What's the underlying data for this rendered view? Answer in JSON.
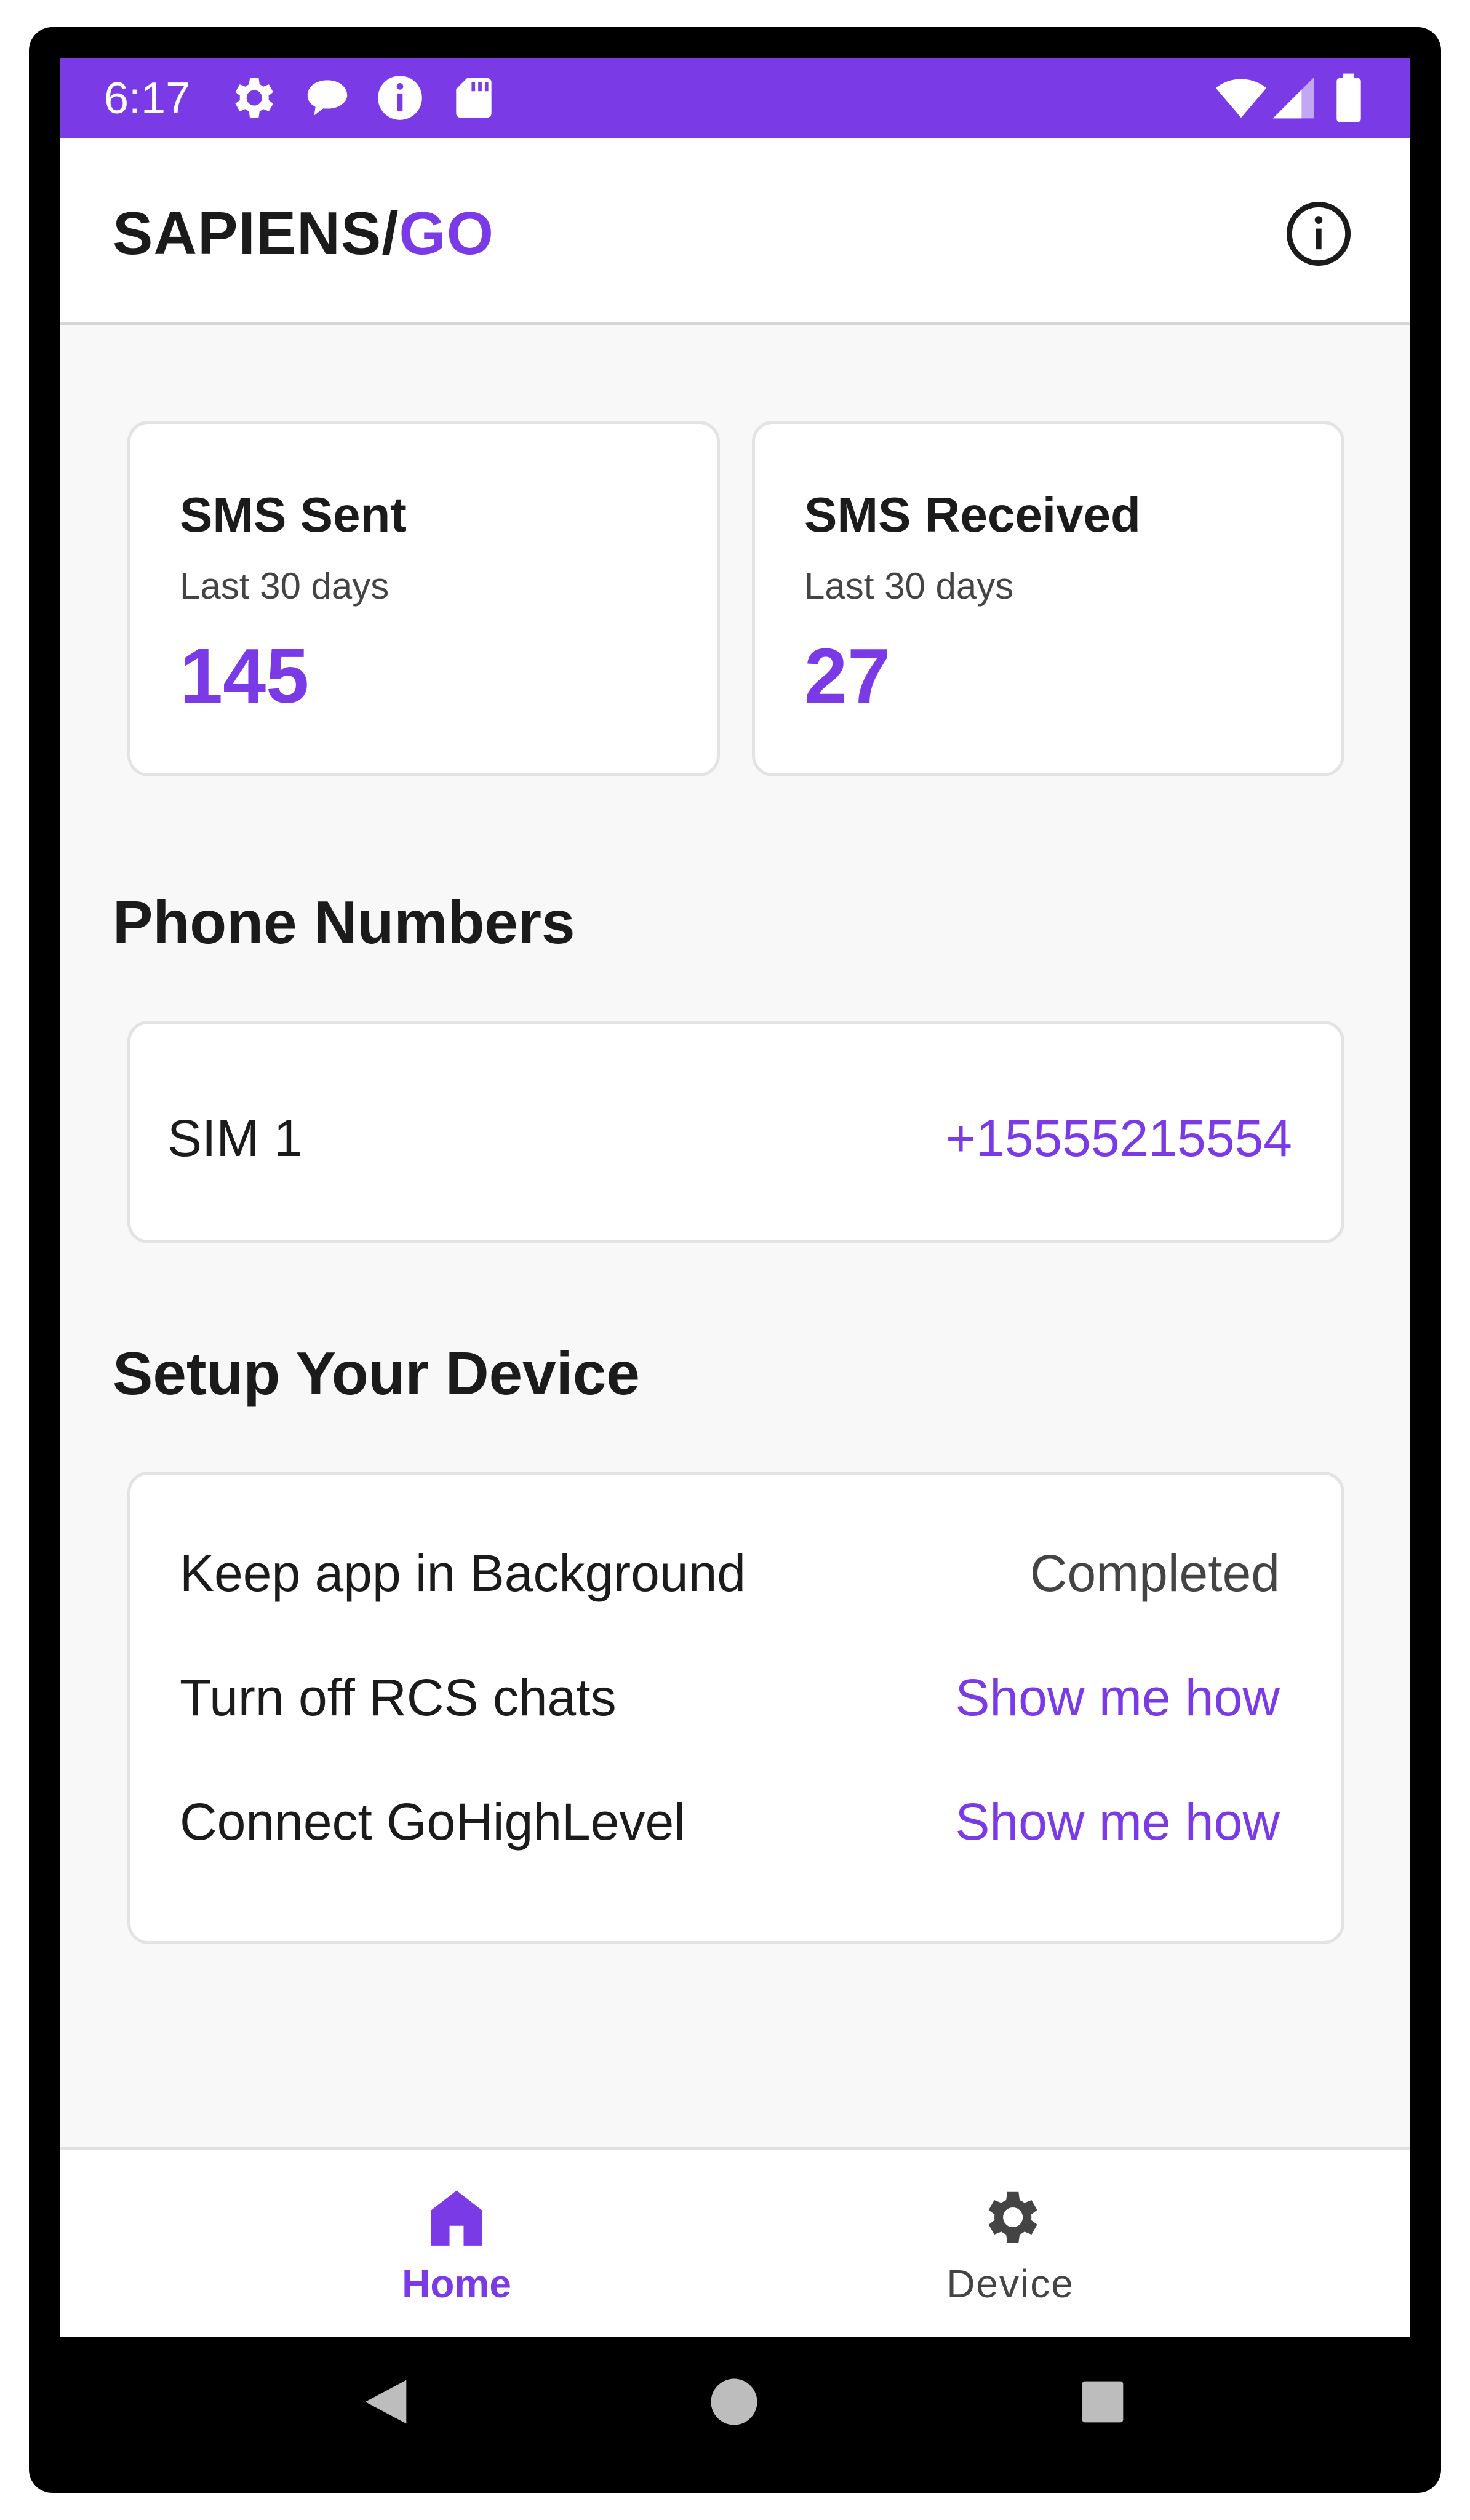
{
  "status_bar": {
    "time": "6:17",
    "left_icons": [
      "gear-icon",
      "chat-bubble-icon",
      "info-icon",
      "sd-card-icon"
    ],
    "right_icons": [
      "wifi-icon",
      "cell-signal-icon",
      "battery-icon"
    ]
  },
  "app_bar": {
    "brand_primary": "SAPIENS/",
    "brand_accent": "GO",
    "info_icon": "info-circle-icon"
  },
  "stats": [
    {
      "title": "SMS Sent",
      "subtitle": "Last 30 days",
      "value": "145"
    },
    {
      "title": "SMS Received",
      "subtitle": "Last 30 days",
      "value": "27"
    }
  ],
  "phone_numbers": {
    "heading": "Phone Numbers",
    "sim_label": "SIM 1",
    "number": "+15555215554"
  },
  "setup": {
    "heading": "Setup Your Device",
    "items": [
      {
        "label": "Keep app in Background",
        "status": "Completed"
      },
      {
        "label": "Turn off RCS chats",
        "status": "Show me how"
      },
      {
        "label": "Connect GoHighLevel",
        "status": "Show me how"
      }
    ]
  },
  "bottom_nav": {
    "items": [
      {
        "label": "Home",
        "icon": "home-icon",
        "active": true
      },
      {
        "label": "Device",
        "icon": "gear-icon",
        "active": false
      }
    ]
  },
  "system_nav": [
    "back-icon",
    "home-circle-icon",
    "recents-square-icon"
  ],
  "colors": {
    "accent": "#7a3ae6",
    "text": "#1b1b1b",
    "muted": "#444444",
    "background": "#f8f8f8"
  }
}
